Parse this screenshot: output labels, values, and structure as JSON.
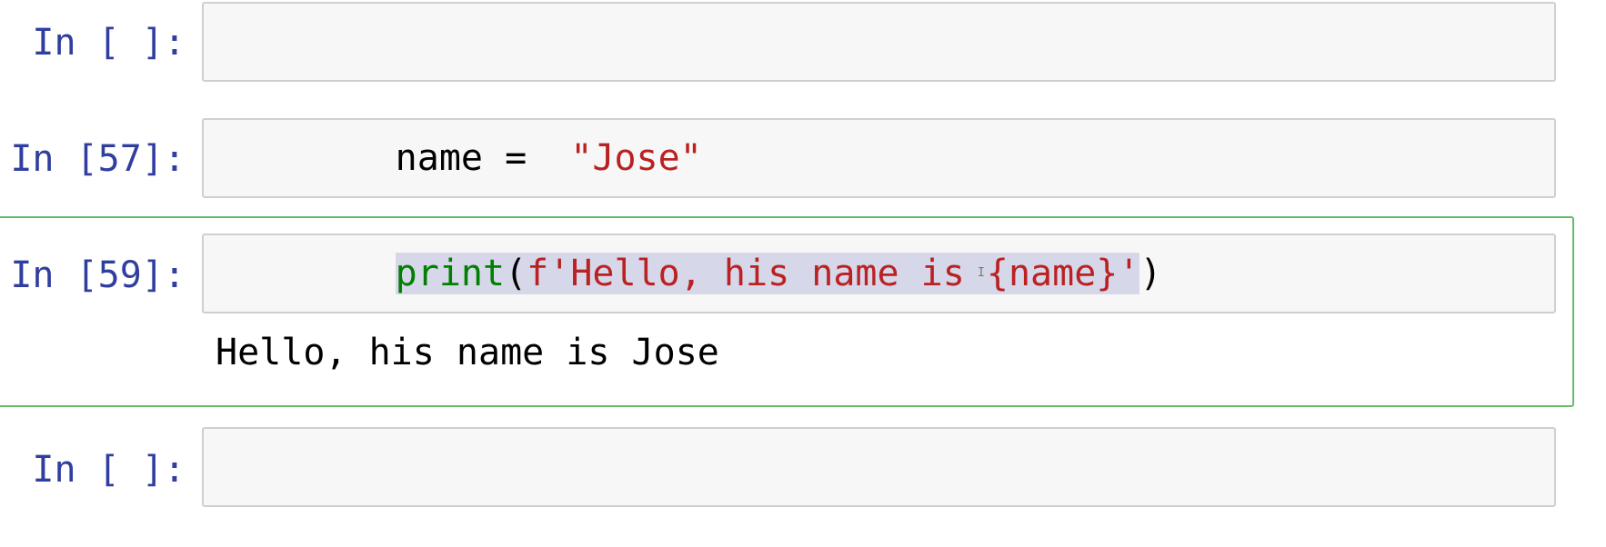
{
  "cells": [
    {
      "prompt": "In [ ]:",
      "code": ""
    },
    {
      "prompt": "In [57]:",
      "code": {
        "variable": "name =  ",
        "string": "\"Jose\""
      }
    },
    {
      "prompt": "In [59]:",
      "code": {
        "function": "print",
        "open_paren": "(",
        "string": "f'Hello, his name is {name}'",
        "close_paren": ")"
      },
      "output": "Hello, his name is Jose"
    },
    {
      "prompt": "In [ ]:",
      "code": ""
    }
  ],
  "cursor_icon": "text-cursor-icon",
  "cursor_glyph": "I",
  "colors": {
    "prompt": "#303f9f",
    "string": "#ba2121",
    "builtin": "#008000",
    "selected_border": "#66bb6a",
    "input_background": "#f7f7f7"
  }
}
